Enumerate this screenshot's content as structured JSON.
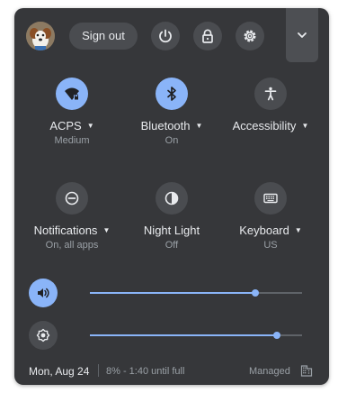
{
  "topbar": {
    "sign_out_label": "Sign out",
    "avatar": "user-avatar-dog",
    "icons": [
      "power-icon",
      "lock-icon",
      "gear-icon",
      "chevron-down-icon"
    ]
  },
  "tiles": [
    {
      "label": "ACPS",
      "sub": "Medium",
      "icon": "wifi-icon",
      "active": true,
      "has_menu": true
    },
    {
      "label": "Bluetooth",
      "sub": "On",
      "icon": "bluetooth-icon",
      "active": true,
      "has_menu": true
    },
    {
      "label": "Accessibility",
      "sub": "",
      "icon": "accessibility-icon",
      "active": false,
      "has_menu": true
    },
    {
      "label": "Notifications",
      "sub": "On, all apps",
      "icon": "do-not-disturb-icon",
      "active": false,
      "has_menu": true
    },
    {
      "label": "Night Light",
      "sub": "Off",
      "icon": "night-light-icon",
      "active": false,
      "has_menu": false
    },
    {
      "label": "Keyboard",
      "sub": "US",
      "icon": "keyboard-icon",
      "active": false,
      "has_menu": true
    }
  ],
  "sliders": {
    "volume": {
      "icon": "volume-icon",
      "level": 0.78
    },
    "brightness": {
      "icon": "brightness-icon",
      "level": 0.88
    }
  },
  "footer": {
    "date": "Mon, Aug 24",
    "battery": "8% - 1:40 until full",
    "managed": "Managed"
  },
  "colors": {
    "panel": "#36373a",
    "accent": "#8ab4f8",
    "button": "#4a4c50",
    "text": "#e8eaed",
    "subtext": "#9aa0a6"
  }
}
